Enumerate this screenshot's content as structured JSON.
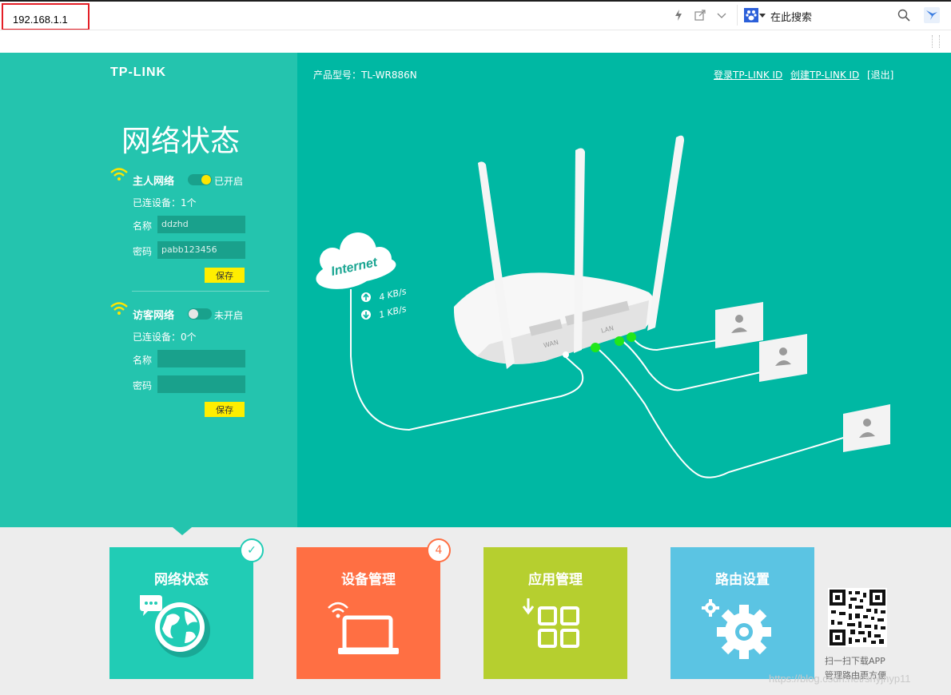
{
  "browser": {
    "url": "192.168.1.1",
    "search_placeholder": "在此搜索",
    "icons": [
      "lightning-icon",
      "share-icon",
      "chevron-down-icon",
      "paw-icon",
      "search-icon",
      "bird-icon"
    ]
  },
  "app": {
    "brand": "TP-LINK",
    "model_label": "产品型号：TL-WR886N",
    "links": {
      "login": "登录TP-LINK ID",
      "create": "创建TP-LINK ID",
      "logout": "[退出]"
    },
    "page_title": "网络状态",
    "host_network": {
      "title": "主人网络",
      "toggle_state": "已开启",
      "enabled": true,
      "devices_label": "已连设备：1个",
      "name_label": "名称",
      "name_value": "ddzhd",
      "password_label": "密码",
      "password_value": "pabb123456",
      "save_label": "保存"
    },
    "guest_network": {
      "title": "访客网络",
      "toggle_state": "未开启",
      "enabled": false,
      "devices_label": "已连设备：0个",
      "name_label": "名称",
      "name_value": "",
      "password_label": "密码",
      "password_value": "",
      "save_label": "保存"
    },
    "diagram": {
      "cloud_label": "Internet",
      "upload": "4 KB/s",
      "download": "1 KB/s",
      "router_port_labels": [
        "WAN",
        "LAN"
      ]
    },
    "tiles": [
      {
        "label": "网络状态",
        "color": "#21ccb5",
        "badge": "check"
      },
      {
        "label": "设备管理",
        "color": "#ff6f43",
        "badge": "4"
      },
      {
        "label": "应用管理",
        "color": "#b6cf2f"
      },
      {
        "label": "路由设置",
        "color": "#5bc4e3"
      }
    ],
    "qr": {
      "caption_line1": "扫一扫下载APP",
      "caption_line2": "管理路由更方便"
    },
    "watermark": "https://blog.csdn.net/shyjhyp11"
  }
}
